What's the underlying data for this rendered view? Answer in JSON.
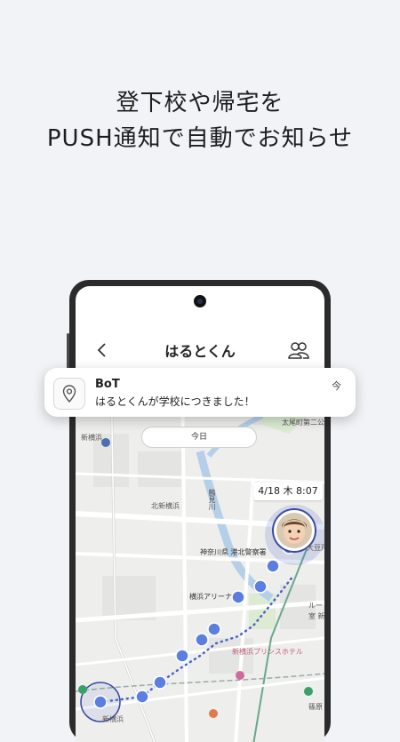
{
  "headline": {
    "line1": "登下校や帰宅を",
    "line2": "PUSH通知で自動でお知らせ"
  },
  "app": {
    "title": "はるとくん",
    "back_icon": "chevron-left-icon",
    "members_icon": "people-icon"
  },
  "map": {
    "date_pill": "今日",
    "time_label": "4/18 木 8:07",
    "labels": {
      "shin_yokohama_station": "新横浜",
      "kita_shin_yokohama": "北新横浜",
      "tsurumi_river": "鶴見川",
      "kanagawa_police": "神奈川県 港北警察署",
      "yokohama_arena": "横浜アリーナ",
      "prince_hotel": "新横浜プリンスホテル",
      "tahoocho": "太尾町第二公",
      "oto": "大豆戸",
      "shinyokohama_bottom": "新横浜",
      "shinohara": "篠原",
      "lumine": "ルー",
      "lumine2": "室 新"
    },
    "accent_color": "#3a4aa0",
    "route_color": "#4a64c8"
  },
  "notification": {
    "app_name": "BoT",
    "message": "はるとくんが学校につきました！",
    "time": "今",
    "icon": "location-pin-icon"
  }
}
